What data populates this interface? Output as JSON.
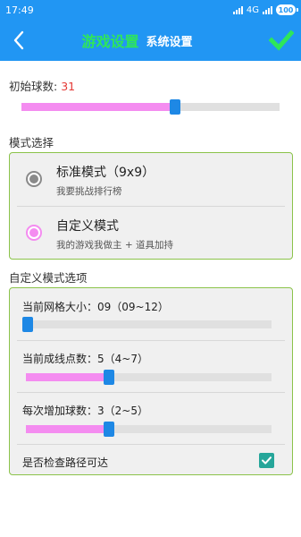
{
  "status_bar": {
    "time": "17:49",
    "network": "4G",
    "battery": "100"
  },
  "header": {
    "active_title": "游戏设置",
    "inactive_title": "系统设置",
    "back_icon": "chevron-left-icon",
    "confirm_icon": "checkmark-icon"
  },
  "initial_balls": {
    "label": "初始球数:",
    "value": "31",
    "fraction": 0.6
  },
  "mode_select": {
    "heading": "模式选择",
    "options": [
      {
        "title": "标准模式（9x9）",
        "subtitle": "我要挑战排行榜",
        "selected": false
      },
      {
        "title": "自定义模式",
        "subtitle": "我的游戏我做主 + 道具加持",
        "selected": true
      }
    ]
  },
  "custom_options": {
    "heading": "自定义模式选项",
    "grid_size": {
      "label": "当前网格大小：09（09~12）",
      "fraction": 0.0
    },
    "line_points": {
      "label": "当前成线点数：5（4~7）",
      "fraction": 0.33
    },
    "balls_per_turn": {
      "label": "每次增加球数：3（2~5）",
      "fraction": 0.33
    },
    "check_path": {
      "label": "是否检查路径可达",
      "checked": true
    }
  },
  "colors": {
    "app_bar": "#2196f3",
    "active_title": "#2ee65a",
    "slider_fill": "#f48cf0",
    "slider_thumb": "#1e88e5",
    "group_border": "#8bc34a",
    "checkbox": "#26a69a",
    "highlight_value": "#e53935"
  }
}
